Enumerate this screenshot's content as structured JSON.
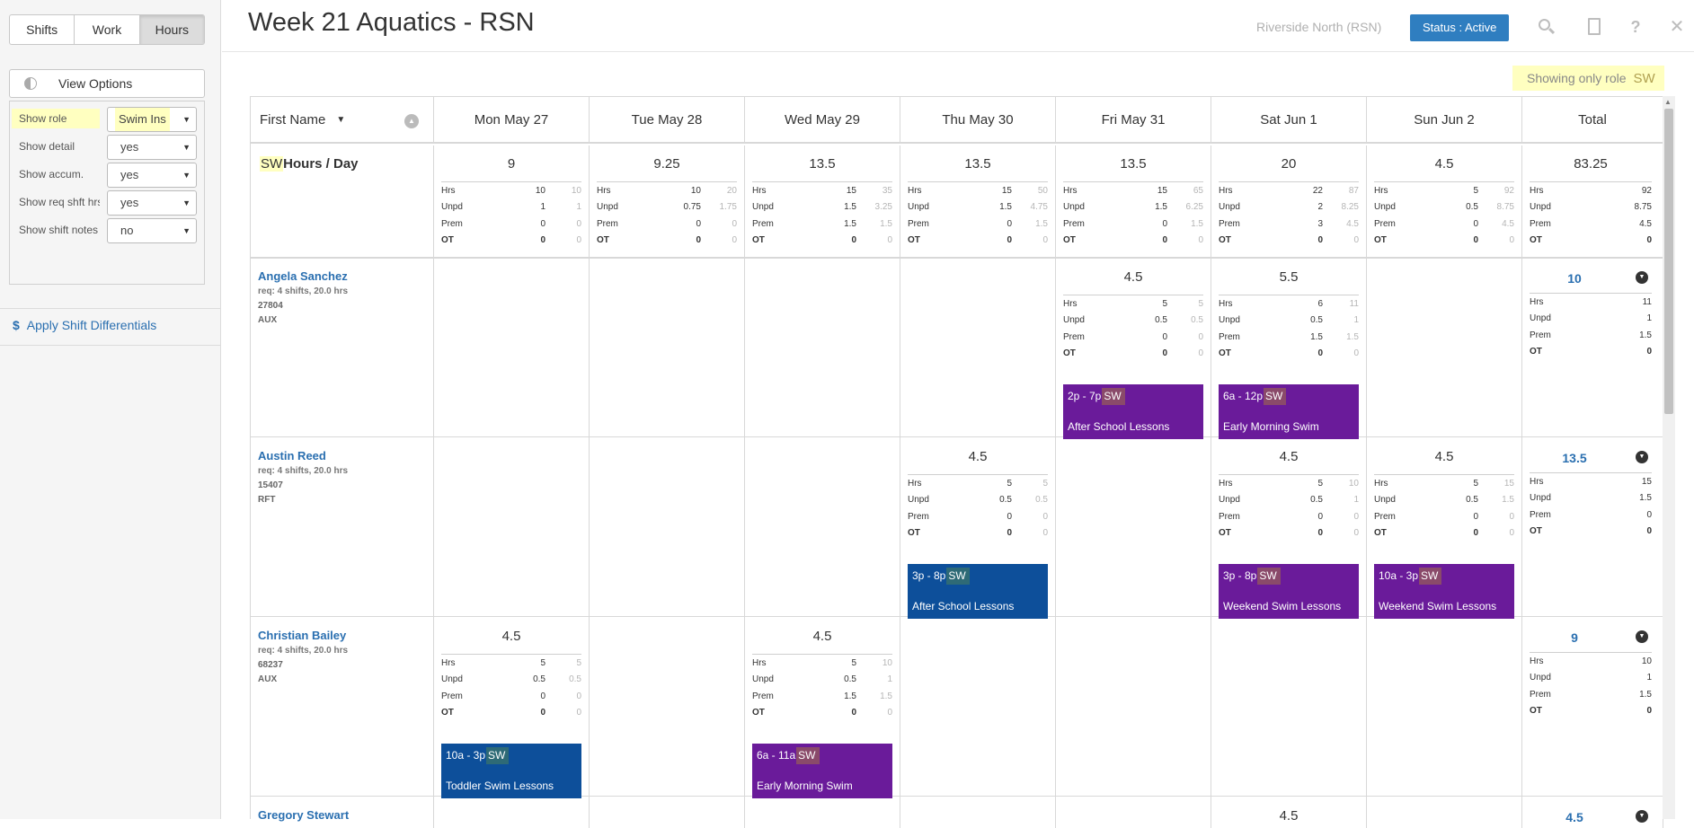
{
  "sidebar": {
    "tabs": [
      {
        "label": "Shifts",
        "active": false
      },
      {
        "label": "Work",
        "active": false
      },
      {
        "label": "Hours",
        "active": true
      }
    ],
    "view_options_label": "View Options",
    "options": [
      {
        "label": "Show role",
        "value": "Swim Ins",
        "highlight": true
      },
      {
        "label": "Show detail",
        "value": "yes",
        "highlight": false
      },
      {
        "label": "Show accum.",
        "value": "yes",
        "highlight": false
      },
      {
        "label": "Show req shft hrs",
        "value": "yes",
        "highlight": false
      },
      {
        "label": "Show shift notes",
        "value": "no",
        "highlight": false
      }
    ],
    "apply_label": "Apply Shift Differentials"
  },
  "header": {
    "title": "Week 21 Aquatics - RSN",
    "location": "Riverside North (RSN)",
    "status": "Status : Active"
  },
  "role_badge": {
    "text": "Showing only role",
    "code": "SW"
  },
  "grid": {
    "columns": [
      "First Name",
      "Mon May 27",
      "Tue May 28",
      "Wed May 29",
      "Thu May 30",
      "Fri May 31",
      "Sat Jun 1",
      "Sun Jun 2",
      "Total"
    ],
    "hours_row": {
      "role": "SW",
      "title": "Hours / Day",
      "days": [
        {
          "total": "9",
          "rows": [
            [
              "Hrs",
              "10",
              "10"
            ],
            [
              "Unpd",
              "1",
              "1"
            ],
            [
              "Prem",
              "0",
              "0"
            ],
            [
              "OT",
              "0",
              "0"
            ]
          ]
        },
        {
          "total": "9.25",
          "rows": [
            [
              "Hrs",
              "10",
              "20"
            ],
            [
              "Unpd",
              "0.75",
              "1.75"
            ],
            [
              "Prem",
              "0",
              "0"
            ],
            [
              "OT",
              "0",
              "0"
            ]
          ]
        },
        {
          "total": "13.5",
          "rows": [
            [
              "Hrs",
              "15",
              "35"
            ],
            [
              "Unpd",
              "1.5",
              "3.25"
            ],
            [
              "Prem",
              "1.5",
              "1.5"
            ],
            [
              "OT",
              "0",
              "0"
            ]
          ]
        },
        {
          "total": "13.5",
          "rows": [
            [
              "Hrs",
              "15",
              "50"
            ],
            [
              "Unpd",
              "1.5",
              "4.75"
            ],
            [
              "Prem",
              "0",
              "1.5"
            ],
            [
              "OT",
              "0",
              "0"
            ]
          ]
        },
        {
          "total": "13.5",
          "rows": [
            [
              "Hrs",
              "15",
              "65"
            ],
            [
              "Unpd",
              "1.5",
              "6.25"
            ],
            [
              "Prem",
              "0",
              "1.5"
            ],
            [
              "OT",
              "0",
              "0"
            ]
          ]
        },
        {
          "total": "20",
          "rows": [
            [
              "Hrs",
              "22",
              "87"
            ],
            [
              "Unpd",
              "2",
              "8.25"
            ],
            [
              "Prem",
              "3",
              "4.5"
            ],
            [
              "OT",
              "0",
              "0"
            ]
          ]
        },
        {
          "total": "4.5",
          "rows": [
            [
              "Hrs",
              "5",
              "92"
            ],
            [
              "Unpd",
              "0.5",
              "8.75"
            ],
            [
              "Prem",
              "0",
              "4.5"
            ],
            [
              "OT",
              "0",
              "0"
            ]
          ]
        }
      ],
      "total": {
        "value": "83.25",
        "rows": [
          [
            "Hrs",
            "92"
          ],
          [
            "Unpd",
            "8.75"
          ],
          [
            "Prem",
            "4.5"
          ],
          [
            "OT",
            "0"
          ]
        ]
      }
    },
    "employees": [
      {
        "name": "Angela Sanchez",
        "req": "req: 4 shifts, 20.0 hrs",
        "id": "27804",
        "type": "AUX",
        "days": [
          null,
          null,
          null,
          null,
          {
            "total": "4.5",
            "rows": [
              [
                "Hrs",
                "5",
                "5"
              ],
              [
                "Unpd",
                "0.5",
                "0.5"
              ],
              [
                "Prem",
                "0",
                "0"
              ],
              [
                "OT",
                "0",
                "0"
              ]
            ],
            "shift": {
              "time": "2p - 7p",
              "tag": "SW",
              "name": "After School Lessons",
              "color": "purple"
            }
          },
          {
            "total": "5.5",
            "rows": [
              [
                "Hrs",
                "6",
                "11"
              ],
              [
                "Unpd",
                "0.5",
                "1"
              ],
              [
                "Prem",
                "1.5",
                "1.5"
              ],
              [
                "OT",
                "0",
                "0"
              ]
            ],
            "shift": {
              "time": "6a - 12p",
              "tag": "SW",
              "name": "Early Morning Swim",
              "color": "purple"
            }
          },
          null
        ],
        "total": {
          "value": "10",
          "rows": [
            [
              "Hrs",
              "11"
            ],
            [
              "Unpd",
              "1"
            ],
            [
              "Prem",
              "1.5"
            ],
            [
              "OT",
              "0"
            ]
          ]
        }
      },
      {
        "name": "Austin Reed",
        "req": "req: 4 shifts, 20.0 hrs",
        "id": "15407",
        "type": "RFT",
        "days": [
          null,
          null,
          null,
          {
            "total": "4.5",
            "rows": [
              [
                "Hrs",
                "5",
                "5"
              ],
              [
                "Unpd",
                "0.5",
                "0.5"
              ],
              [
                "Prem",
                "0",
                "0"
              ],
              [
                "OT",
                "0",
                "0"
              ]
            ],
            "shift": {
              "time": "3p - 8p",
              "tag": "SW",
              "name": "After School Lessons",
              "color": "blue"
            }
          },
          null,
          {
            "total": "4.5",
            "rows": [
              [
                "Hrs",
                "5",
                "10"
              ],
              [
                "Unpd",
                "0.5",
                "1"
              ],
              [
                "Prem",
                "0",
                "0"
              ],
              [
                "OT",
                "0",
                "0"
              ]
            ],
            "shift": {
              "time": "3p - 8p",
              "tag": "SW",
              "name": "Weekend Swim Lessons",
              "color": "purple"
            }
          },
          {
            "total": "4.5",
            "rows": [
              [
                "Hrs",
                "5",
                "15"
              ],
              [
                "Unpd",
                "0.5",
                "1.5"
              ],
              [
                "Prem",
                "0",
                "0"
              ],
              [
                "OT",
                "0",
                "0"
              ]
            ],
            "shift": {
              "time": "10a - 3p",
              "tag": "SW",
              "name": "Weekend Swim Lessons",
              "color": "purple"
            }
          }
        ],
        "total": {
          "value": "13.5",
          "rows": [
            [
              "Hrs",
              "15"
            ],
            [
              "Unpd",
              "1.5"
            ],
            [
              "Prem",
              "0"
            ],
            [
              "OT",
              "0"
            ]
          ]
        }
      },
      {
        "name": "Christian Bailey",
        "req": "req: 4 shifts, 20.0 hrs",
        "id": "68237",
        "type": "AUX",
        "days": [
          {
            "total": "4.5",
            "rows": [
              [
                "Hrs",
                "5",
                "5"
              ],
              [
                "Unpd",
                "0.5",
                "0.5"
              ],
              [
                "Prem",
                "0",
                "0"
              ],
              [
                "OT",
                "0",
                "0"
              ]
            ],
            "shift": {
              "time": "10a - 3p",
              "tag": "SW",
              "name": "Toddler Swim Lessons",
              "color": "blue"
            }
          },
          null,
          {
            "total": "4.5",
            "rows": [
              [
                "Hrs",
                "5",
                "10"
              ],
              [
                "Unpd",
                "0.5",
                "1"
              ],
              [
                "Prem",
                "1.5",
                "1.5"
              ],
              [
                "OT",
                "0",
                "0"
              ]
            ],
            "shift": {
              "time": "6a - 11a",
              "tag": "SW",
              "name": "Early Morning Swim",
              "color": "purple"
            }
          },
          null,
          null,
          null,
          null
        ],
        "total": {
          "value": "9",
          "rows": [
            [
              "Hrs",
              "10"
            ],
            [
              "Unpd",
              "1"
            ],
            [
              "Prem",
              "1.5"
            ],
            [
              "OT",
              "0"
            ]
          ]
        }
      },
      {
        "name": "Gregory Stewart",
        "days": [
          null,
          null,
          null,
          null,
          null,
          {
            "total": "4.5"
          },
          null
        ],
        "total": {
          "value": "4.5"
        }
      }
    ]
  }
}
